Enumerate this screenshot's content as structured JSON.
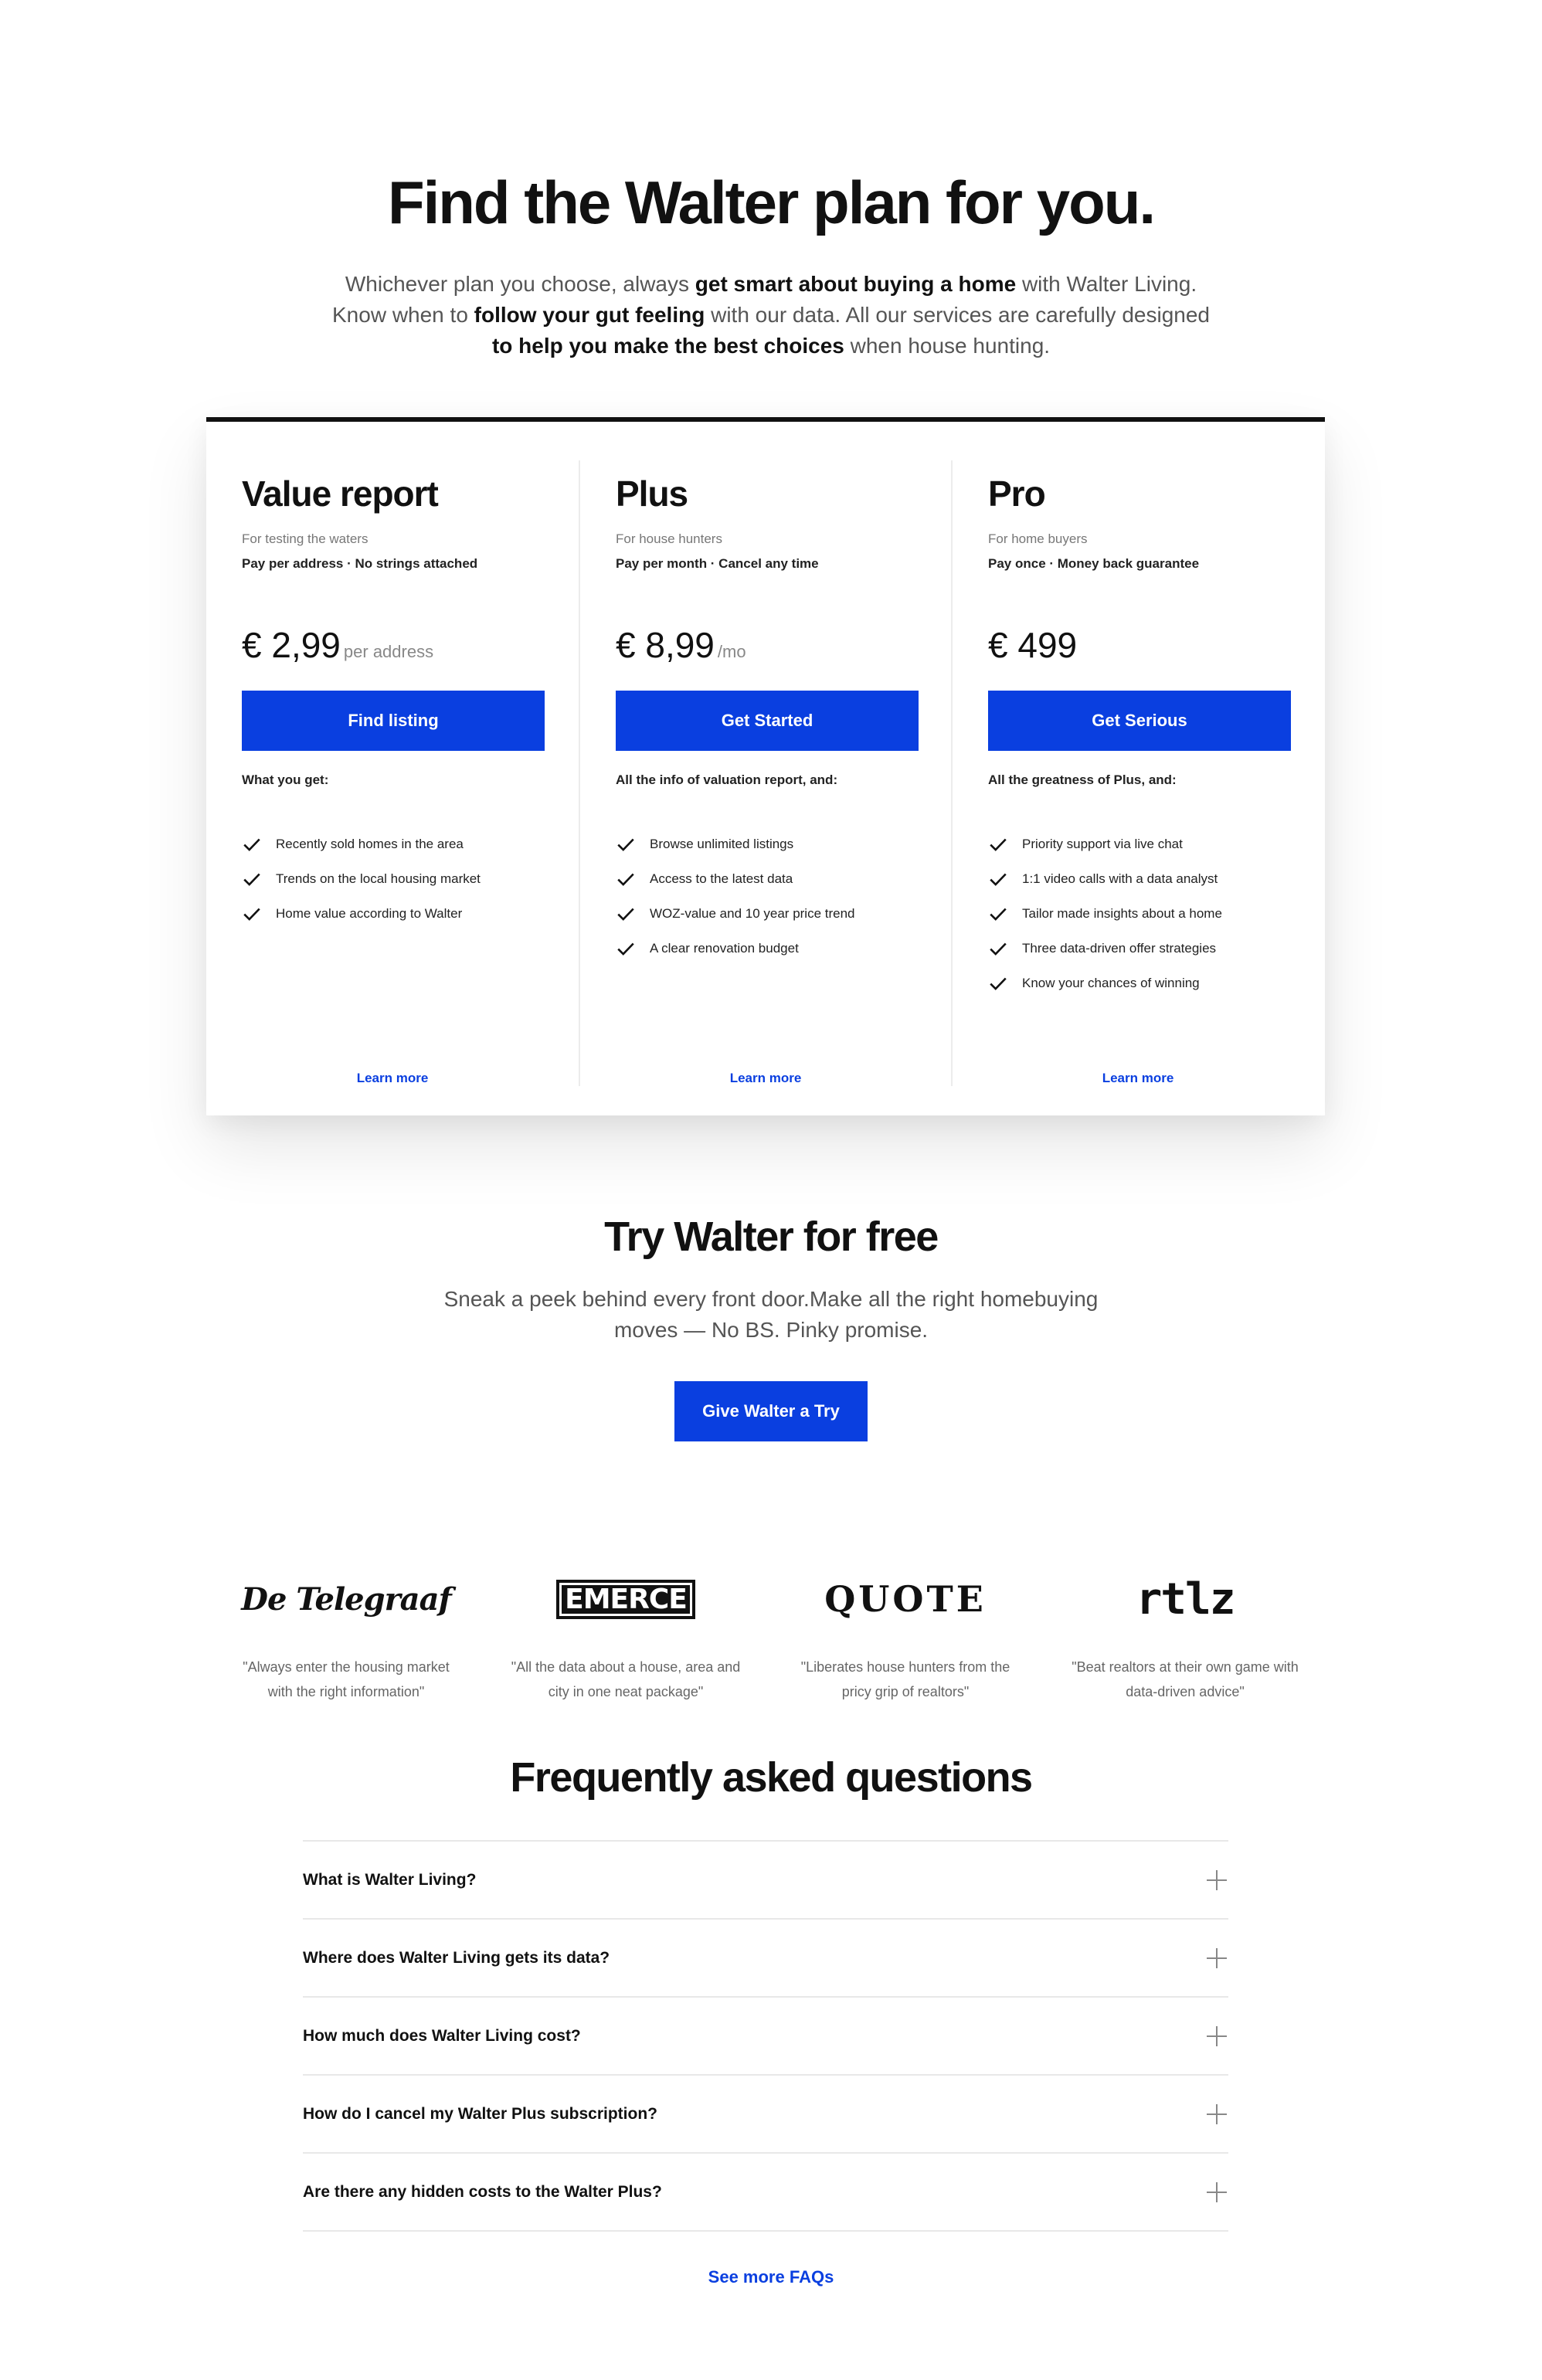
{
  "hero": {
    "title": "Find the Walter plan for you.",
    "line1_a": "Whichever plan you choose, always ",
    "line1_b": "get smart about buying a home",
    "line1_c": " with Walter Living.",
    "line2_a": "Know when to ",
    "line2_b": "follow your gut feeling",
    "line2_c": " with our data. All our services are carefully designed",
    "line3_b": "to help you make the best choices",
    "line3_c": " when house hunting."
  },
  "plans": [
    {
      "name": "Value report",
      "tagline": "For testing the waters",
      "terms": "Pay per address · No strings attached",
      "price": "€ 2,99",
      "price_unit": "per address",
      "cta": "Find listing",
      "lead": "What you get:",
      "features": [
        "Recently sold homes in the area",
        "Trends on the local housing market",
        "Home value according to Walter"
      ],
      "learn_more": "Learn more"
    },
    {
      "name": "Plus",
      "tagline": "For house hunters",
      "terms": "Pay per month · Cancel any time",
      "price": "€ 8,99",
      "price_unit": "/mo",
      "cta": "Get Started",
      "lead": "All the info of valuation report, and:",
      "features": [
        "Browse unlimited listings",
        "Access to the latest data",
        "WOZ-value and 10 year price trend",
        "A clear renovation budget"
      ],
      "learn_more": "Learn more"
    },
    {
      "name": "Pro",
      "tagline": "For home buyers",
      "terms": "Pay once · Money back guarantee",
      "price": "€ 499",
      "price_unit": "",
      "cta": "Get Serious",
      "lead": "All the greatness of Plus, and:",
      "features": [
        "Priority support via live chat",
        "1:1 video calls with a data analyst",
        "Tailor made insights about a home",
        "Three data-driven offer strategies",
        "Know your chances of winning"
      ],
      "learn_more": "Learn more"
    }
  ],
  "try": {
    "title": "Try Walter for free",
    "text": "Sneak a peek behind every front door.Make all the right homebuying moves — No BS. Pinky promise.",
    "cta": "Give Walter a Try"
  },
  "press": [
    {
      "logo": "De Telegraaf",
      "quote": "\"Always enter the housing market with the right information\""
    },
    {
      "logo": "EMERCE",
      "quote": "\"All the data about a house, area and city in one neat package\""
    },
    {
      "logo": "QUOTE",
      "quote": "\"Liberates house hunters from the pricy grip of realtors\""
    },
    {
      "logo": "rtlz",
      "quote": "\"Beat realtors at their own game with data-driven advice\""
    }
  ],
  "faq": {
    "title": "Frequently asked questions",
    "items": [
      "What is Walter Living?",
      "Where does Walter Living gets its data?",
      "How much does Walter Living cost?",
      "How do I cancel my Walter Plus subscription?",
      "Are there any hidden costs to the Walter Plus?"
    ],
    "more": "See more FAQs"
  },
  "colors": {
    "accent": "#0a3fe0",
    "text": "#111111",
    "muted": "#555555"
  },
  "icons": {
    "feature": "check-icon",
    "faq_toggle": "plus-icon"
  }
}
